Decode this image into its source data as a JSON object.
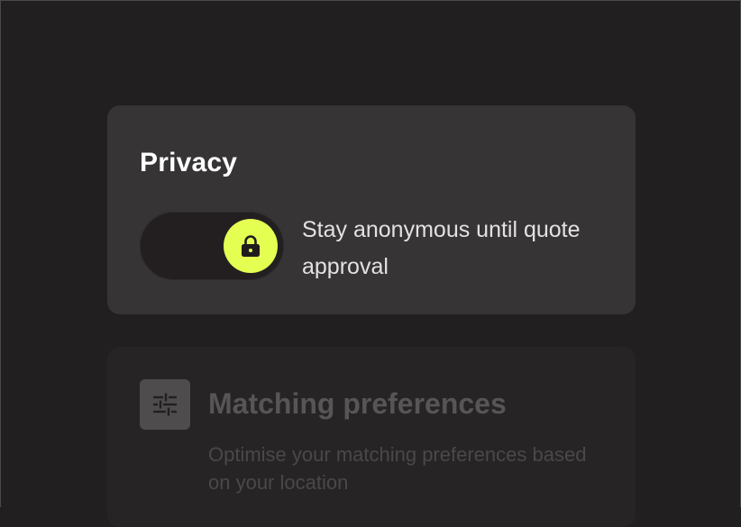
{
  "privacy": {
    "title": "Privacy",
    "toggle": {
      "state": "on",
      "description": "Stay anonymous until quote approval",
      "knob_icon": "lock-icon",
      "knob_color": "#e4ff52"
    }
  },
  "matching": {
    "icon": "sliders-icon",
    "title": "Matching preferences",
    "description": "Optimise your matching preferences based on your location"
  },
  "colors": {
    "background": "#211f20",
    "card": "#363435",
    "card_muted": "#262425",
    "accent": "#e4ff52"
  }
}
